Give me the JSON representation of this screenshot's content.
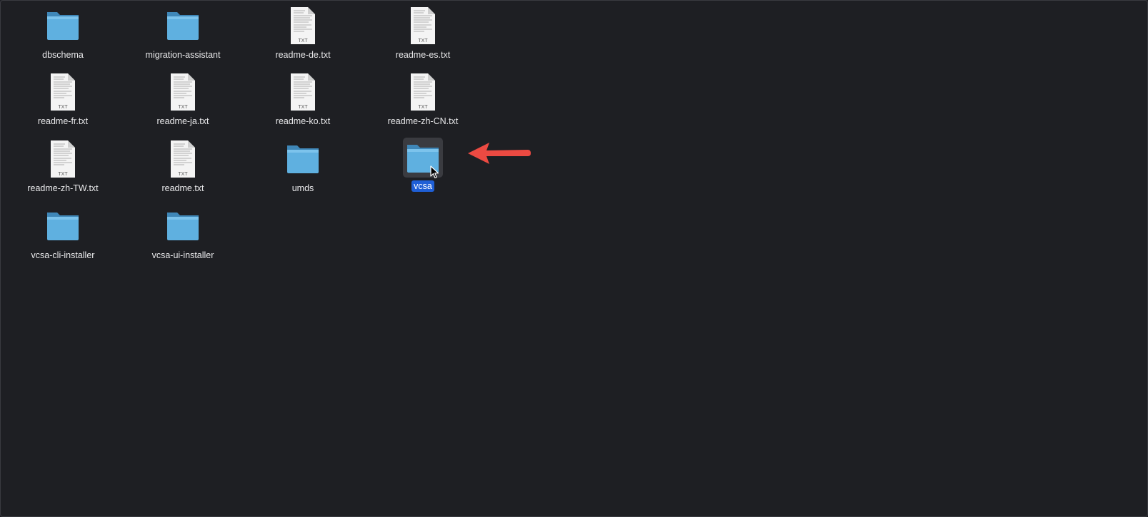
{
  "finder": {
    "items": [
      {
        "name": "dbschema",
        "kind": "folder",
        "icon": "folder-icon"
      },
      {
        "name": "migration-assistant",
        "kind": "folder",
        "icon": "folder-icon"
      },
      {
        "name": "readme-de.txt",
        "kind": "txt",
        "icon": "txt-file-icon",
        "badge": "TXT"
      },
      {
        "name": "readme-es.txt",
        "kind": "txt",
        "icon": "txt-file-icon",
        "badge": "TXT"
      },
      {
        "name": "readme-fr.txt",
        "kind": "txt",
        "icon": "txt-file-icon",
        "badge": "TXT"
      },
      {
        "name": "readme-ja.txt",
        "kind": "txt",
        "icon": "txt-file-icon",
        "badge": "TXT"
      },
      {
        "name": "readme-ko.txt",
        "kind": "txt",
        "icon": "txt-file-icon",
        "badge": "TXT"
      },
      {
        "name": "readme-zh-CN.txt",
        "kind": "txt",
        "icon": "txt-file-icon",
        "badge": "TXT"
      },
      {
        "name": "readme-zh-TW.txt",
        "kind": "txt",
        "icon": "txt-file-icon",
        "badge": "TXT"
      },
      {
        "name": "readme.txt",
        "kind": "txt",
        "icon": "txt-file-icon",
        "badge": "TXT"
      },
      {
        "name": "umds",
        "kind": "folder",
        "icon": "folder-icon"
      },
      {
        "name": "vcsa",
        "kind": "folder",
        "icon": "folder-icon",
        "selected": true
      },
      {
        "name": "vcsa-cli-installer",
        "kind": "folder",
        "icon": "folder-icon"
      },
      {
        "name": "vcsa-ui-installer",
        "kind": "folder",
        "icon": "folder-icon"
      }
    ]
  },
  "colors": {
    "background": "#1e1f23",
    "selection": "#1f5fd6",
    "folder": "#5fb0e0",
    "annotation_arrow": "#ec4a42"
  }
}
